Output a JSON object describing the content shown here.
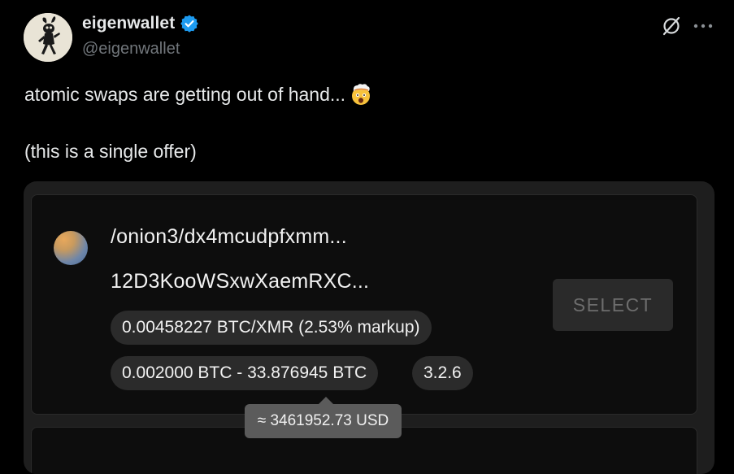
{
  "author": {
    "display_name": "eigenwallet",
    "handle": "@eigenwallet",
    "avatar_icon": "eigenwallet-logo-icon",
    "verified_icon": "verified-badge-icon",
    "verified_color": "#1d9bf0"
  },
  "header_actions": {
    "grok_icon": "grok-icon",
    "more_icon": "more-options-icon"
  },
  "tweet": {
    "line1": "atomic swaps are getting out of hand...",
    "emoji": "exploding-head-emoji-icon",
    "line2": "(this is a single offer)"
  },
  "offer": {
    "address_line1": "/onion3/dx4mcudpfxmm...",
    "address_line2": "12D3KooWSxwXaemRXC...",
    "rate_chip": "0.00458227 BTC/XMR (2.53% markup)",
    "range_chip": "0.002000 BTC - 33.876945 BTC",
    "version_chip": "3.2.6",
    "select_label": "SELECT",
    "tooltip": "≈ 3461952.73 USD"
  },
  "colors": {
    "background": "#000000",
    "text_primary": "#e7e9ea",
    "text_secondary": "#71767b",
    "card_bg": "#0d0d0d",
    "chip_bg": "#2b2b2b",
    "tooltip_bg": "#5b5b5b"
  }
}
